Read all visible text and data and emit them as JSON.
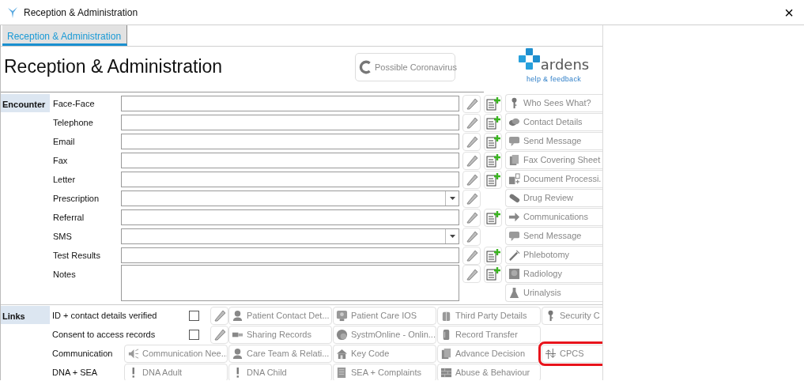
{
  "window": {
    "title": "Reception & Administration",
    "close": "×"
  },
  "tabs": [
    {
      "label": "Reception & Administration",
      "selected": true
    }
  ],
  "header": {
    "title": "Reception & Administration",
    "button": {
      "label": "Possible Coronavirus"
    }
  },
  "logo": {
    "name": "ardens",
    "link": "help & feedback"
  },
  "encounter": {
    "label": "Encounter",
    "rows": [
      {
        "label": "Face-Face",
        "kind": "text",
        "add_note": true
      },
      {
        "label": "Telephone",
        "kind": "text",
        "add_note": true
      },
      {
        "label": "Email",
        "kind": "text",
        "add_note": true
      },
      {
        "label": "Fax",
        "kind": "text",
        "add_note": true
      },
      {
        "label": "Letter",
        "kind": "text",
        "add_note": true
      },
      {
        "label": "Prescription",
        "kind": "select",
        "add_note": false
      },
      {
        "label": "Referral",
        "kind": "text",
        "add_note": true
      },
      {
        "label": "SMS",
        "kind": "select",
        "add_note": false
      },
      {
        "label": "Test Results",
        "kind": "text",
        "add_note": true
      },
      {
        "label": "Notes",
        "kind": "textarea",
        "add_note": true
      }
    ]
  },
  "side_buttons": [
    {
      "label": "Who Sees What?",
      "kind": "key"
    },
    {
      "label": "Contact Details",
      "kind": "phone"
    },
    {
      "label": "Send Message",
      "kind": "chat"
    },
    {
      "label": "Fax Covering Sheet",
      "kind": "pages"
    },
    {
      "label": "Document Processi.",
      "kind": "docplus"
    },
    {
      "label": "Drug Review",
      "kind": "pill"
    },
    {
      "label": "Communications",
      "kind": "arrow"
    },
    {
      "label": "Send Message",
      "kind": "chat"
    },
    {
      "label": "Phlebotomy",
      "kind": "syringe"
    },
    {
      "label": "Radiology",
      "kind": "scan"
    },
    {
      "label": "Urinalysis",
      "kind": "flask"
    }
  ],
  "links": {
    "label": "Links",
    "rows": [
      {
        "label": "ID + contact details verified",
        "kind": "check",
        "checked": false,
        "buttons": [
          {
            "label": "Patient Contact Det...",
            "kind": "person",
            "highlighted": false
          },
          {
            "label": "Patient Care IOS",
            "kind": "monitor",
            "highlighted": false
          },
          {
            "label": "Third Party Details",
            "kind": "gift",
            "highlighted": false
          },
          {
            "label": "Security C",
            "kind": "key",
            "highlighted": false
          }
        ]
      },
      {
        "label": "Consent to access records",
        "kind": "check",
        "checked": false,
        "buttons": [
          {
            "label": "Sharing Records",
            "kind": "hand",
            "highlighted": false
          },
          {
            "label": "SystmOnline - Onlin...",
            "kind": "globe",
            "highlighted": false
          },
          {
            "label": "Record Transfer",
            "kind": "file",
            "highlighted": false
          }
        ]
      },
      {
        "label": "Communication",
        "kind": "plain",
        "buttons": [
          {
            "label": "Communication Nee...",
            "kind": "speaker",
            "highlighted": false
          },
          {
            "label": "Care Team & Relati...",
            "kind": "person",
            "highlighted": false
          },
          {
            "label": "Key Code",
            "kind": "house",
            "highlighted": false
          },
          {
            "label": "Advance Decision",
            "kind": "pages",
            "highlighted": false
          },
          {
            "label": "CPCS",
            "kind": "swap",
            "highlighted": true
          }
        ]
      },
      {
        "label": "DNA + SEA",
        "kind": "plain",
        "buttons": [
          {
            "label": "DNA Adult",
            "kind": "alert",
            "highlighted": false
          },
          {
            "label": "DNA Child",
            "kind": "alert",
            "highlighted": false
          },
          {
            "label": "SEA + Complaints",
            "kind": "notepad",
            "highlighted": false
          },
          {
            "label": "Abuse & Behaviour",
            "kind": "brick",
            "highlighted": false
          }
        ]
      }
    ]
  }
}
